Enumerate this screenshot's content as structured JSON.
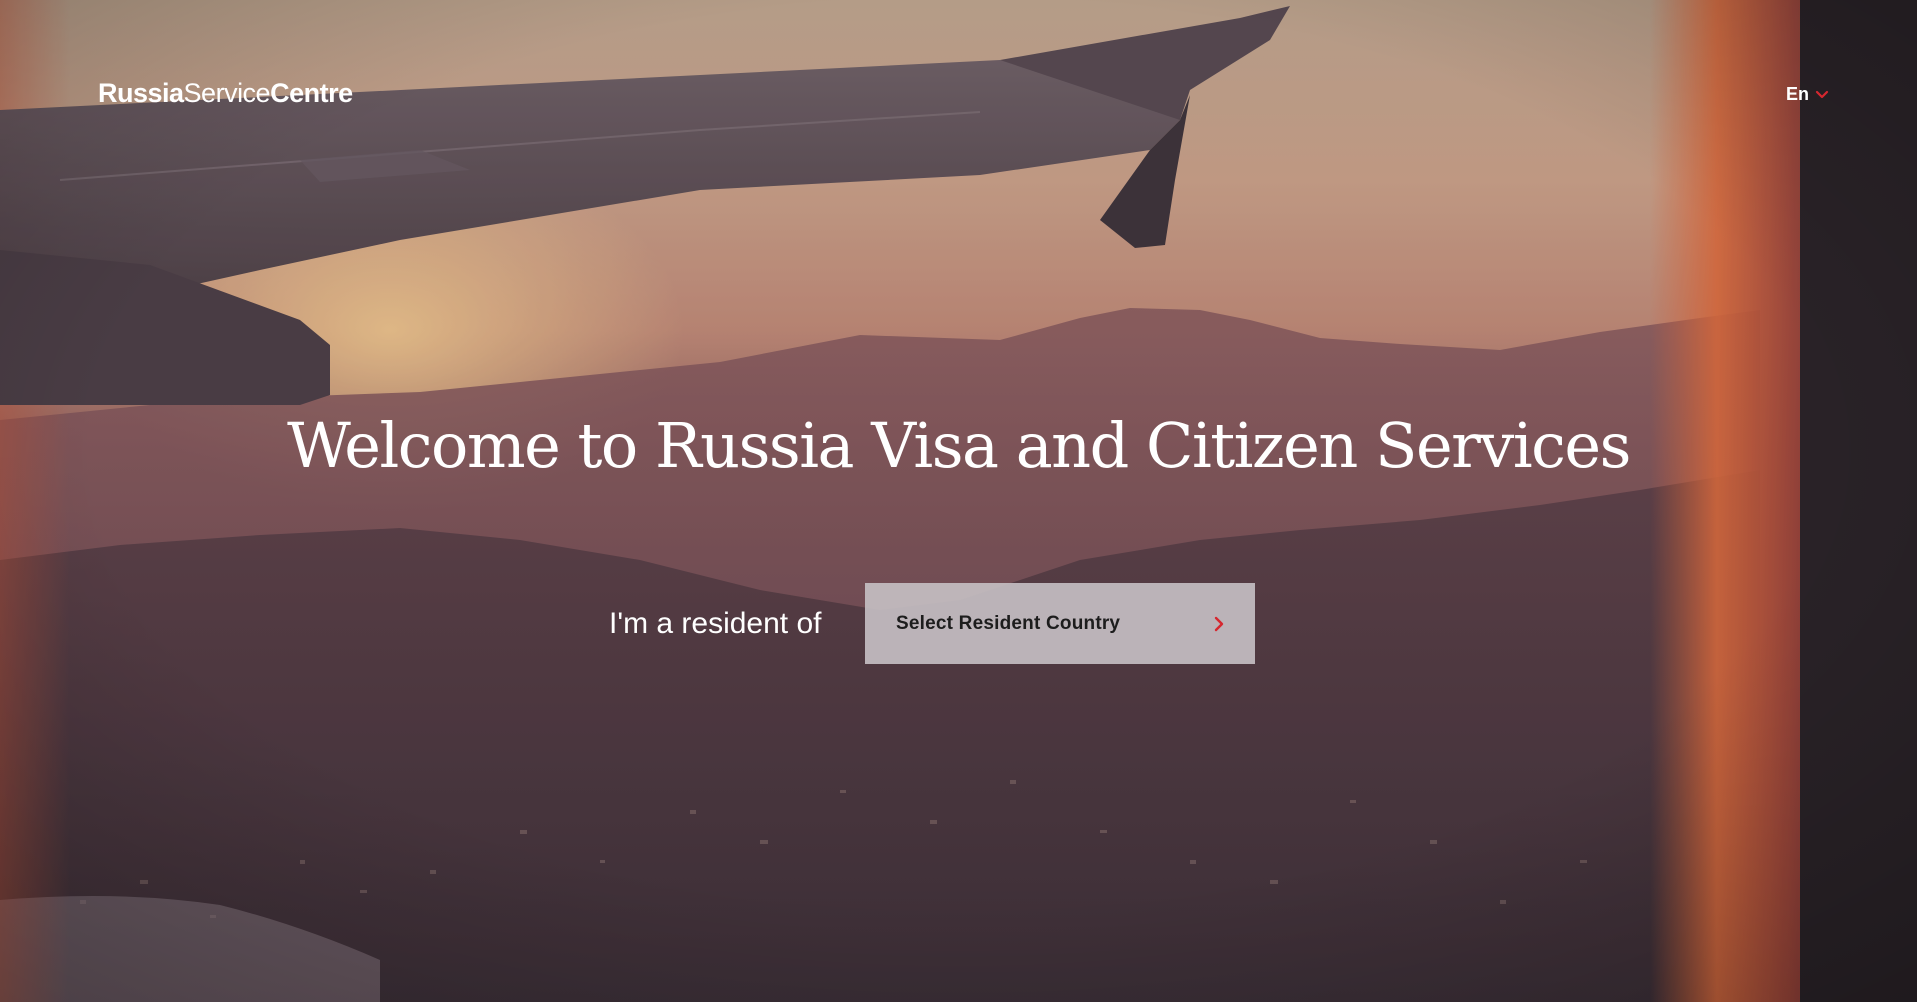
{
  "header": {
    "logo": {
      "part1": "Russia",
      "part2": "Service",
      "part3": "Centre"
    },
    "language": {
      "selected": "En",
      "icon": "chevron-down-icon"
    }
  },
  "hero": {
    "title": "Welcome to Russia Visa and Citizen Services",
    "resident_label": "I'm a resident of",
    "country_select": {
      "placeholder": "Select Resident Country",
      "icon": "chevron-right-icon"
    },
    "background": "airplane-window-sunset-photo"
  },
  "colors": {
    "accent": "#d6272f",
    "text": "#ffffff",
    "select_bg": "#c4bec2",
    "select_text": "#1d1d1d"
  }
}
